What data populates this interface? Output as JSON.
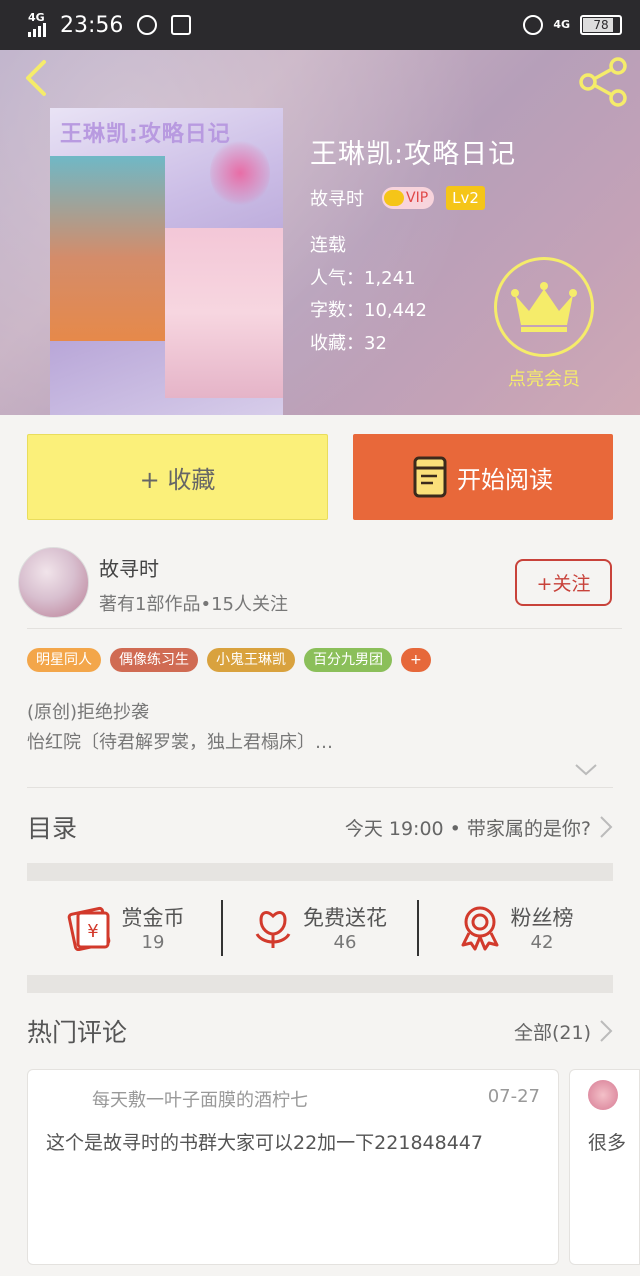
{
  "status_bar": {
    "network": "4G",
    "time": "23:56",
    "network2": "4G",
    "battery": "78"
  },
  "book": {
    "title": "王琳凯:攻略日记",
    "cover_text": "王琳凯:攻略日记",
    "author": "故寻时",
    "vip_label": "VIP",
    "level": "Lv2",
    "status": "连载",
    "popularity": "人气：1,241",
    "words": "字数：10,442",
    "favorites": "收藏：32",
    "member_label": "点亮会员"
  },
  "actions": {
    "collect_label": "+ 收藏",
    "read_label": "开始阅读"
  },
  "author_section": {
    "name": "故寻时",
    "sub": "著有1部作品•15人关注",
    "follow_label": "+关注"
  },
  "tags": [
    {
      "label": "明星同人",
      "color": "#f3a64a"
    },
    {
      "label": "偶像练习生",
      "color": "#d06b53"
    },
    {
      "label": "小鬼王琳凯",
      "color": "#d9a23e"
    },
    {
      "label": "百分九男团",
      "color": "#8bbf5a"
    },
    {
      "label": "+",
      "color": "#e6683a"
    }
  ],
  "description": {
    "line1": "(原创)拒绝抄袭",
    "line2": "怡红院〔待君解罗裳，独上君榻床〕…"
  },
  "toc": {
    "title": "目录",
    "latest": "今天 19:00 • 带家属的是你?"
  },
  "rewards": [
    {
      "label": "赏金币",
      "count": "19",
      "icon": "red-envelope-icon"
    },
    {
      "label": "免费送花",
      "count": "46",
      "icon": "flower-icon"
    },
    {
      "label": "粉丝榜",
      "count": "42",
      "icon": "medal-icon"
    }
  ],
  "comments_section": {
    "title": "热门评论",
    "all_label": "全部(21)"
  },
  "comments": [
    {
      "user": "每天敷一叶子面膜的酒柠七",
      "date": "07-27",
      "text": "这个是故寻时的书群大家可以22加一下221848447"
    },
    {
      "text": "很多"
    }
  ]
}
